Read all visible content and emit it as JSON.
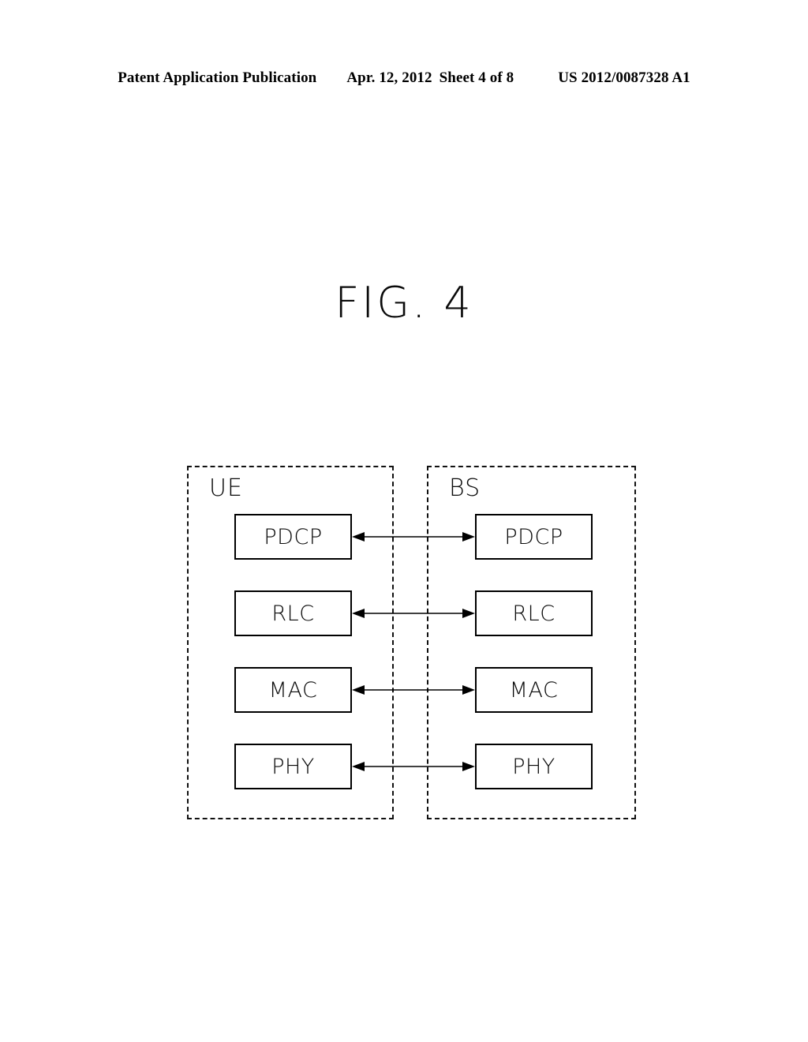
{
  "header": {
    "publication": "Patent Application Publication",
    "date": "Apr. 12, 2012",
    "sheet": "Sheet 4 of 8",
    "patent_number": "US 2012/0087328 A1"
  },
  "figure": {
    "title": "FIG. 4",
    "caption": "FIG. 4"
  },
  "diagram": {
    "type": "protocol-stack",
    "nodes": [
      {
        "id": "ue",
        "label": "UE",
        "layers": [
          {
            "label": "PDCP"
          },
          {
            "label": "RLC"
          },
          {
            "label": "MAC"
          },
          {
            "label": "PHY"
          }
        ]
      },
      {
        "id": "bs",
        "label": "BS",
        "layers": [
          {
            "label": "PDCP"
          },
          {
            "label": "RLC"
          },
          {
            "label": "MAC"
          },
          {
            "label": "PHY"
          }
        ]
      }
    ],
    "connections": [
      {
        "layer": "PDCP",
        "from": "ue",
        "to": "bs",
        "direction": "bidirectional"
      },
      {
        "layer": "RLC",
        "from": "ue",
        "to": "bs",
        "direction": "bidirectional"
      },
      {
        "layer": "MAC",
        "from": "ue",
        "to": "bs",
        "direction": "bidirectional"
      },
      {
        "layer": "PHY",
        "from": "ue",
        "to": "bs",
        "direction": "bidirectional"
      }
    ]
  },
  "colors": {
    "ink": "#000000",
    "page": "#ffffff"
  }
}
